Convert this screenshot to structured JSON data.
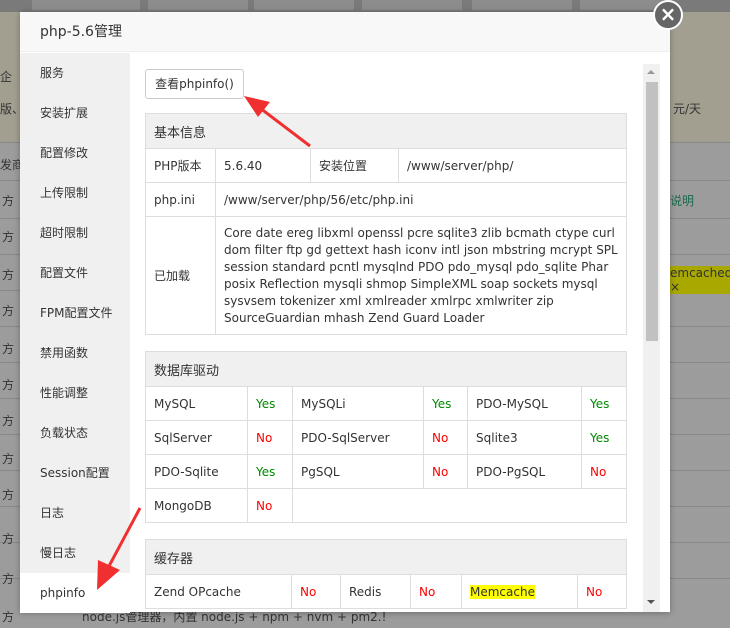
{
  "dialog": {
    "title": "php-5.6管理",
    "close": "×"
  },
  "sidebar": [
    "服务",
    "安装扩展",
    "配置修改",
    "上传限制",
    "超时限制",
    "配置文件",
    "FPM配置文件",
    "禁用函数",
    "性能调整",
    "负载状态",
    "Session配置",
    "日志",
    "慢日志",
    "phpinfo"
  ],
  "phpinfo_button": "查看phpinfo()",
  "basic": {
    "title": "基本信息",
    "version_label": "PHP版本",
    "version": "5.6.40",
    "path_label": "安装位置",
    "path": "/www/server/php/",
    "ini_label": "php.ini",
    "ini": "/www/server/php/56/etc/php.ini",
    "loaded_label": "已加载",
    "loaded": "Core date ereg libxml openssl pcre sqlite3 zlib bcmath ctype curl dom filter ftp gd gettext hash iconv intl json mbstring mcrypt SPL session standard pcntl mysqlnd PDO pdo_mysql pdo_sqlite Phar posix Reflection mysqli shmop SimpleXML soap sockets mysql sysvsem tokenizer xml xmlreader xmlrpc xmlwriter zip SourceGuardian mhash Zend Guard Loader"
  },
  "db": {
    "title": "数据库驱动",
    "rows": [
      [
        [
          "MySQL",
          "Yes"
        ],
        [
          "MySQLi",
          "Yes"
        ],
        [
          "PDO-MySQL",
          "Yes"
        ]
      ],
      [
        [
          "SqlServer",
          "No"
        ],
        [
          "PDO-SqlServer",
          "No"
        ],
        [
          "Sqlite3",
          "Yes"
        ]
      ],
      [
        [
          "PDO-Sqlite",
          "Yes"
        ],
        [
          "PgSQL",
          "No"
        ],
        [
          "PDO-PgSQL",
          "No"
        ]
      ],
      [
        [
          "MongoDB",
          "No"
        ]
      ]
    ]
  },
  "cache": {
    "title": "缓存器",
    "items": [
      [
        "Zend OPcache",
        "No"
      ],
      [
        "Redis",
        "No"
      ],
      [
        "Memcache",
        "No"
      ]
    ]
  },
  "background": {
    "left": [
      "企",
      "版、",
      "发商",
      "方"
    ],
    "right": [
      "元/天",
      "说明",
      "emcached ×"
    ],
    "bottom": "node.js管理器，内置 node.js + npm + nvm + pm2.!"
  },
  "colors": {
    "yes": "#008800",
    "no": "#ff0000",
    "highlight": "#ffff00",
    "arrow": "#f03030"
  }
}
